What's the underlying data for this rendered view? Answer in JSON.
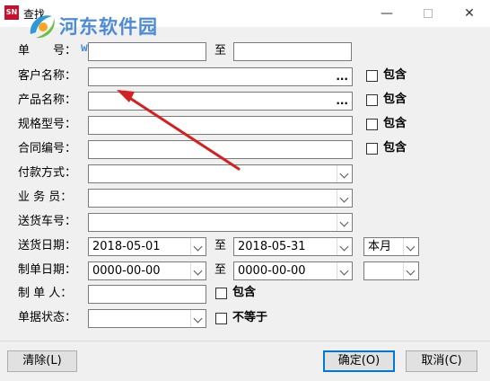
{
  "window": {
    "app_icon": "SN",
    "title": "查找",
    "minimize_glyph": "—",
    "close_glyph": "✕"
  },
  "watermark": {
    "title": "河东软件园",
    "url": "www.pc0359.cn"
  },
  "form": {
    "number": {
      "label": "单　　号：",
      "from": "",
      "to_label": "至",
      "to": ""
    },
    "customer": {
      "label": "客户名称：",
      "value": "",
      "picker": "...",
      "contains": "包含"
    },
    "product": {
      "label": "产品名称：",
      "value": "",
      "picker": "...",
      "contains": "包含"
    },
    "spec": {
      "label": "规格型号：",
      "value": "",
      "contains": "包含"
    },
    "contract": {
      "label": "合同编号：",
      "value": "",
      "contains": "包含"
    },
    "payment": {
      "label": "付款方式：",
      "value": ""
    },
    "salesman": {
      "label": "业 务 员：",
      "value": ""
    },
    "vehicle": {
      "label": "送货车号：",
      "value": ""
    },
    "delivery_date": {
      "label": "送货日期：",
      "from": "2018-05-01",
      "to_label": "至",
      "to": "2018-05-31",
      "period": "本月"
    },
    "make_date": {
      "label": "制单日期：",
      "from": "0000-00-00",
      "to_label": "至",
      "to": "0000-00-00",
      "period": ""
    },
    "maker": {
      "label": "制 单 人：",
      "value": "",
      "contains": "包含"
    },
    "status": {
      "label": "单据状态：",
      "value": "",
      "not_equal": "不等于"
    }
  },
  "buttons": {
    "clear": "清除(L)",
    "ok": "确定(O)",
    "cancel": "取消(C)"
  },
  "annotation": {
    "color": "#d42020"
  }
}
